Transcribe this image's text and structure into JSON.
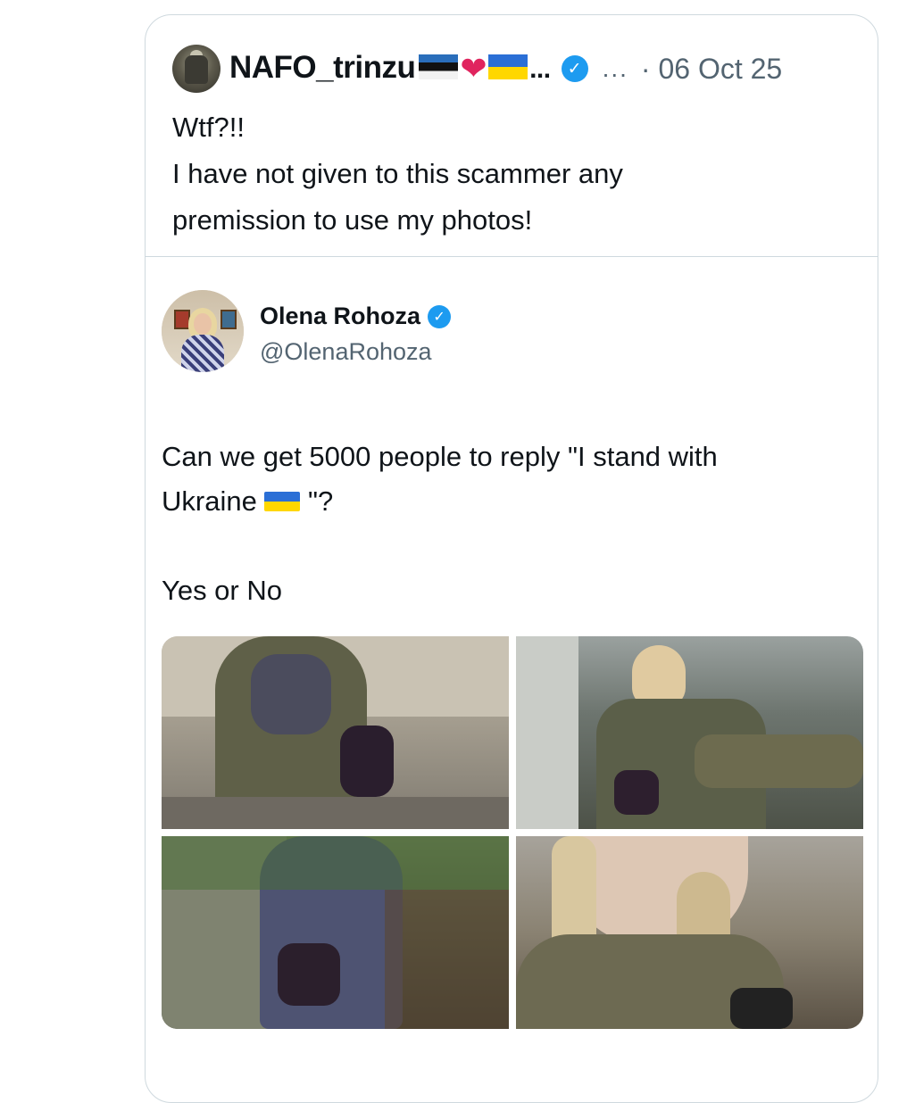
{
  "quote_tweet": {
    "author_name": "NAFO_trinzu",
    "name_suffix": "...",
    "more_label": "...",
    "date": "· 06 Oct 25",
    "lines": [
      "Wtf?!!",
      "I have not given to this scammer any",
      "premission to use my photos!"
    ]
  },
  "quoted_tweet": {
    "author_name": "Olena Rohoza",
    "handle": "@OlenaRohoza",
    "line1": "Can we get 5000 people to reply \"I stand with",
    "line2_prefix": "Ukraine ",
    "line2_suffix": " \"?",
    "line3": "Yes or No",
    "photos": [
      "soldier-sitting-ruins",
      "soldier-in-car",
      "soldier-crouching-foliage",
      "soldier-closeup-braids"
    ]
  },
  "colors": {
    "text": "#0f1419",
    "secondary": "#536471",
    "verified": "#1d9bf0",
    "border": "#cfd9de"
  },
  "icons": [
    "verified-badge-icon",
    "estonia-flag-icon",
    "heart-icon",
    "ukraine-flag-icon"
  ]
}
